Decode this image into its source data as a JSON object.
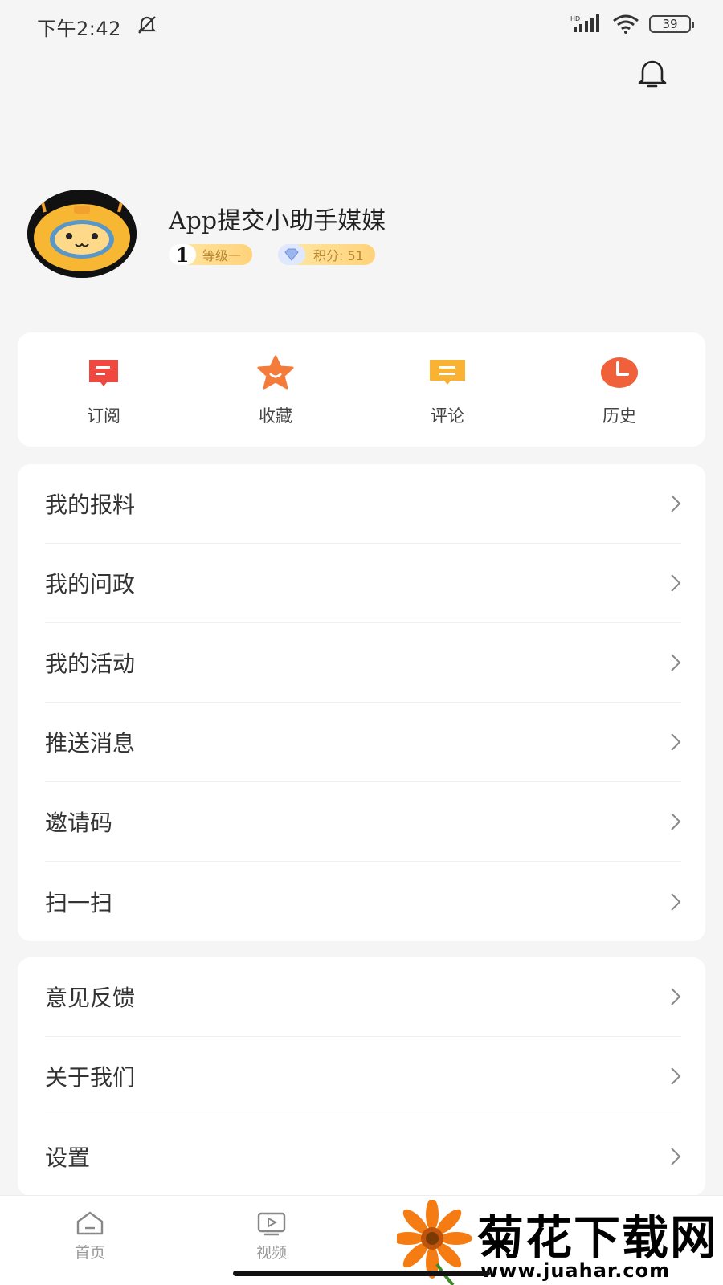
{
  "status_bar": {
    "time": "下午2:42",
    "battery": "39",
    "network_label": "HD"
  },
  "profile": {
    "name": "App提交小助手媒媒",
    "level_number": "1",
    "level_label": "等级一",
    "points_label": "积分: 51"
  },
  "quick_actions": [
    {
      "label": "订阅",
      "icon": "subscribe-icon",
      "color": "#f0483e"
    },
    {
      "label": "收藏",
      "icon": "star-icon",
      "color": "#f47b3a"
    },
    {
      "label": "评论",
      "icon": "comment-icon",
      "color": "#f9b232"
    },
    {
      "label": "历史",
      "icon": "clock-icon",
      "color": "#f0603a"
    }
  ],
  "menu_group_1": [
    {
      "label": "我的报料"
    },
    {
      "label": "我的问政"
    },
    {
      "label": "我的活动"
    },
    {
      "label": "推送消息"
    },
    {
      "label": "邀请码"
    },
    {
      "label": "扫一扫"
    }
  ],
  "menu_group_2": [
    {
      "label": "意见反馈"
    },
    {
      "label": "关于我们"
    },
    {
      "label": "设置"
    }
  ],
  "tab_bar": [
    {
      "label": "首页",
      "icon": "home-icon"
    },
    {
      "label": "视频",
      "icon": "video-icon"
    }
  ],
  "watermark": {
    "title": "菊花下载网",
    "url": "www.juahar.com"
  }
}
